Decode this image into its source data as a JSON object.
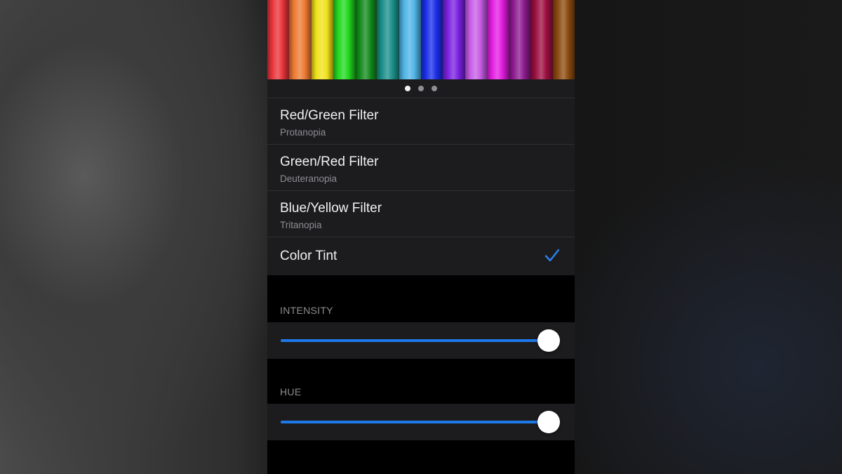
{
  "preview": {
    "pencil_colors": [
      "#e8343a",
      "#ee7a33",
      "#f0e21a",
      "#22d81f",
      "#138a1c",
      "#1b8f8a",
      "#4fb4e6",
      "#1a2ee8",
      "#7a20e0",
      "#c65ce6",
      "#e21ce0",
      "#8d1a90",
      "#9c0f40",
      "#8c4b10"
    ],
    "page_count": 3,
    "active_page": 0
  },
  "filters": [
    {
      "title": "Red/Green Filter",
      "subtitle": "Protanopia",
      "selected": false
    },
    {
      "title": "Green/Red Filter",
      "subtitle": "Deuteranopia",
      "selected": false
    },
    {
      "title": "Blue/Yellow Filter",
      "subtitle": "Tritanopia",
      "selected": false
    },
    {
      "title": "Color Tint",
      "subtitle": "",
      "selected": true
    }
  ],
  "intensity": {
    "label": "INTENSITY",
    "value": 0.99
  },
  "hue": {
    "label": "HUE",
    "value": 0.99
  },
  "colors": {
    "accent": "#1e79e8",
    "checkmark": "#2a84f0"
  }
}
